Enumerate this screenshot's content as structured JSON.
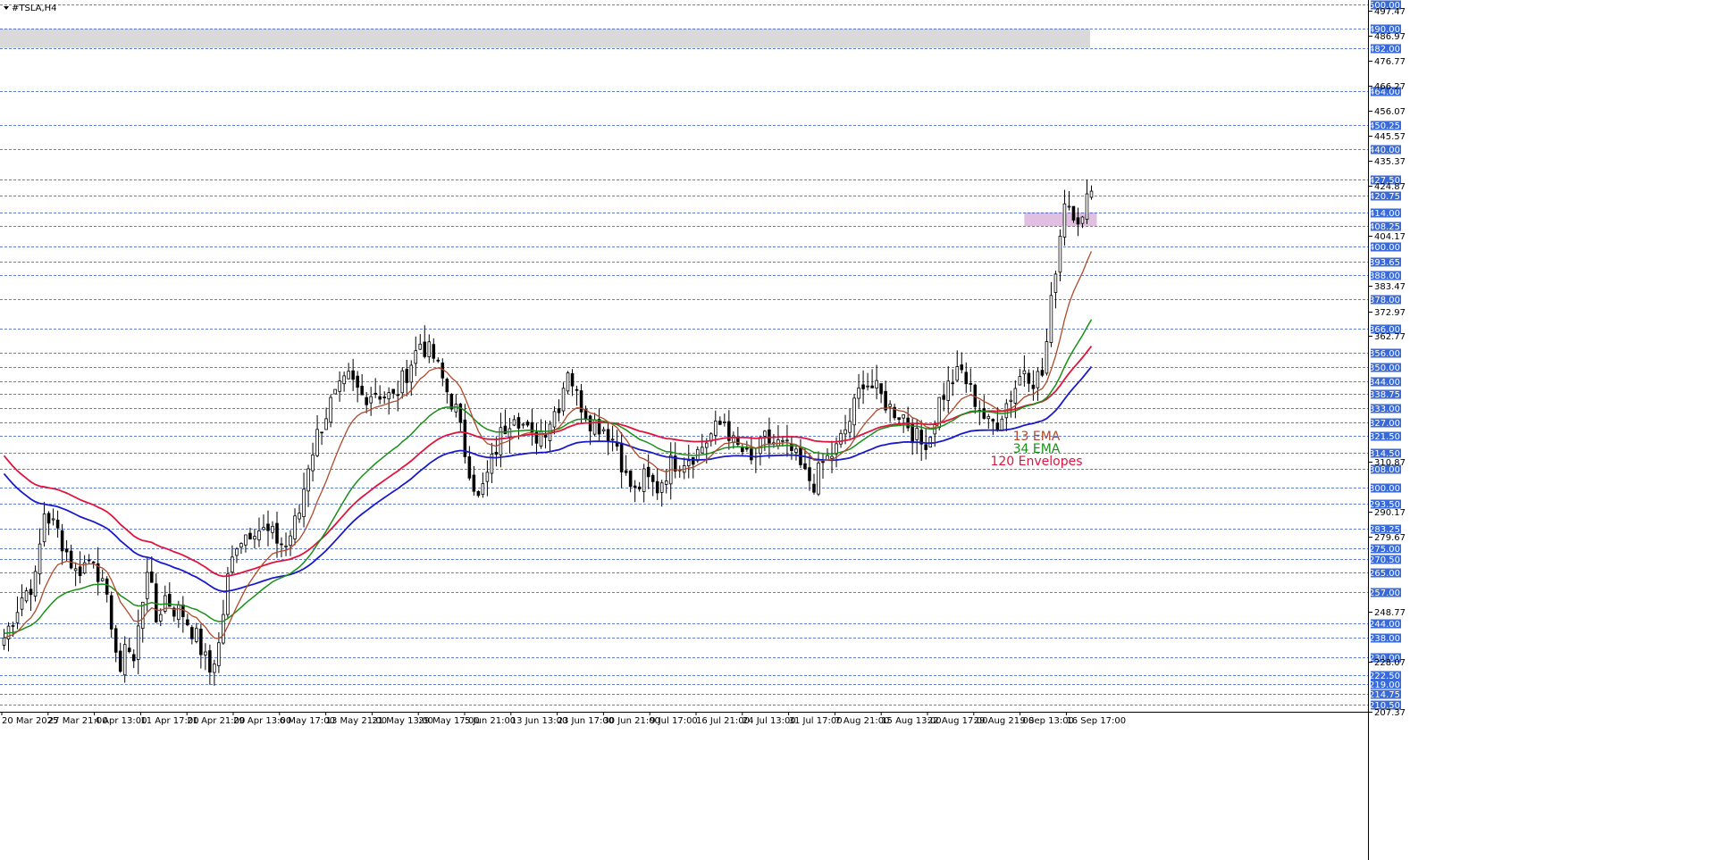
{
  "window": {
    "title": "#TSLA,H4",
    "menu_icon": "triangle-down-icon"
  },
  "legend": [
    {
      "label": "13 EMA",
      "color": "#b04a2a"
    },
    {
      "label": "34 EMA",
      "color": "#189018"
    },
    {
      "label": "120 Envelopes",
      "color": "#e0143c"
    }
  ],
  "colors": {
    "background": "#ffffff",
    "candle": "#000000",
    "ema13": "#b04a2a",
    "ema34": "#189018",
    "env_upper": "#e0143c",
    "env_lower": "#1a1ac8",
    "level_line": "#2a55c8",
    "level_label_bg": "#3a6ad8",
    "resistance_zone": "#d9d9d9",
    "marker_zone": "#dcb4dc"
  },
  "chart_data": {
    "type": "candlestick",
    "symbol": "#TSLA",
    "timeframe": "H4",
    "ylim": [
      207.37,
      500.0
    ],
    "grid": false,
    "x_ticks": [
      "20 Mar 2025",
      "27 Mar 21:00",
      "4 Apr 13:00",
      "11 Apr 17:00",
      "21 Apr 21:00",
      "29 Apr 13:00",
      "6 May 17:00",
      "13 May 21:00",
      "21 May 13:00",
      "29 May 17:00",
      "5 Jun 21:00",
      "13 Jun 13:00",
      "23 Jun 17:00",
      "30 Jun 21:00",
      "9 Jul 17:00",
      "16 Jul 21:00",
      "24 Jul 13:00",
      "31 Jul 17:00",
      "7 Aug 21:00",
      "15 Aug 13:00",
      "22 Aug 17:00",
      "29 Aug 21:00",
      "9 Sep 13:00",
      "16 Sep 17:00"
    ],
    "y_ticks": [
      "497.47",
      "486.97",
      "476.77",
      "466.27",
      "456.07",
      "445.57",
      "435.37",
      "424.87",
      "404.17",
      "383.47",
      "372.97",
      "362.77",
      "310.87",
      "290.17",
      "279.67",
      "248.77",
      "228.07",
      "207.37"
    ],
    "levels": [
      "500.00",
      "490.00",
      "482.00",
      "464.00",
      "450.25",
      "440.00",
      "427.50",
      "420.75",
      "414.00",
      "408.25",
      "400.00",
      "393.65",
      "388.00",
      "378.00",
      "366.00",
      "356.00",
      "350.00",
      "344.00",
      "338.75",
      "333.00",
      "327.00",
      "321.50",
      "314.50",
      "308.00",
      "300.00",
      "293.50",
      "283.25",
      "275.00",
      "270.50",
      "265.00",
      "257.00",
      "244.00",
      "238.00",
      "230.00",
      "222.50",
      "219.00",
      "214.75",
      "210.50"
    ],
    "zones": [
      {
        "name": "resistance",
        "from": 482.0,
        "to": 490.0
      },
      {
        "name": "marker",
        "from": 408.25,
        "to": 414.0
      }
    ],
    "anchors_close": [
      [
        0,
        238
      ],
      [
        4,
        255
      ],
      [
        7,
        262
      ],
      [
        9,
        290
      ],
      [
        12,
        282
      ],
      [
        16,
        265
      ],
      [
        20,
        272
      ],
      [
        24,
        245
      ],
      [
        26,
        220
      ],
      [
        27,
        238
      ],
      [
        29,
        228
      ],
      [
        32,
        268
      ],
      [
        34,
        245
      ],
      [
        36,
        255
      ],
      [
        38,
        250
      ],
      [
        40,
        248
      ],
      [
        43,
        238
      ],
      [
        46,
        224
      ],
      [
        48,
        235
      ],
      [
        50,
        262
      ],
      [
        52,
        278
      ],
      [
        56,
        284
      ],
      [
        60,
        280
      ],
      [
        63,
        276
      ],
      [
        66,
        290
      ],
      [
        68,
        310
      ],
      [
        70,
        322
      ],
      [
        73,
        335
      ],
      [
        77,
        345
      ],
      [
        80,
        338
      ],
      [
        83,
        340
      ],
      [
        87,
        337
      ],
      [
        90,
        348
      ],
      [
        93,
        360
      ],
      [
        96,
        354
      ],
      [
        99,
        340
      ],
      [
        101,
        332
      ],
      [
        103,
        315
      ],
      [
        106,
        295
      ],
      [
        108,
        305
      ],
      [
        111,
        322
      ],
      [
        114,
        332
      ],
      [
        118,
        320
      ],
      [
        121,
        325
      ],
      [
        124,
        335
      ],
      [
        126,
        350
      ],
      [
        128,
        338
      ],
      [
        131,
        328
      ],
      [
        134,
        325
      ],
      [
        137,
        318
      ],
      [
        139,
        304
      ],
      [
        141,
        298
      ],
      [
        143,
        304
      ],
      [
        146,
        300
      ],
      [
        149,
        310
      ],
      [
        152,
        312
      ],
      [
        155,
        315
      ],
      [
        158,
        322
      ],
      [
        161,
        328
      ],
      [
        163,
        318
      ],
      [
        165,
        315
      ],
      [
        167,
        310
      ],
      [
        170,
        320
      ],
      [
        173,
        318
      ],
      [
        176,
        315
      ],
      [
        179,
        305
      ],
      [
        181,
        302
      ],
      [
        183,
        310
      ],
      [
        186,
        316
      ],
      [
        189,
        328
      ],
      [
        192,
        345
      ],
      [
        195,
        340
      ],
      [
        198,
        333
      ],
      [
        201,
        330
      ],
      [
        203,
        323
      ],
      [
        205,
        318
      ],
      [
        207,
        322
      ],
      [
        209,
        336
      ],
      [
        212,
        345
      ],
      [
        214,
        348
      ],
      [
        216,
        340
      ],
      [
        218,
        333
      ],
      [
        220,
        326
      ],
      [
        222,
        328
      ],
      [
        224,
        335
      ],
      [
        226,
        342
      ],
      [
        228,
        350
      ],
      [
        230,
        345
      ],
      [
        232,
        347
      ],
      [
        233,
        360
      ],
      [
        235,
        392
      ],
      [
        236,
        405
      ],
      [
        237,
        420
      ],
      [
        239,
        415
      ],
      [
        241,
        410
      ],
      [
        243,
        427
      ]
    ],
    "candle_count": 244,
    "indicators": [
      "13 EMA",
      "34 EMA",
      "120 Envelopes"
    ]
  }
}
